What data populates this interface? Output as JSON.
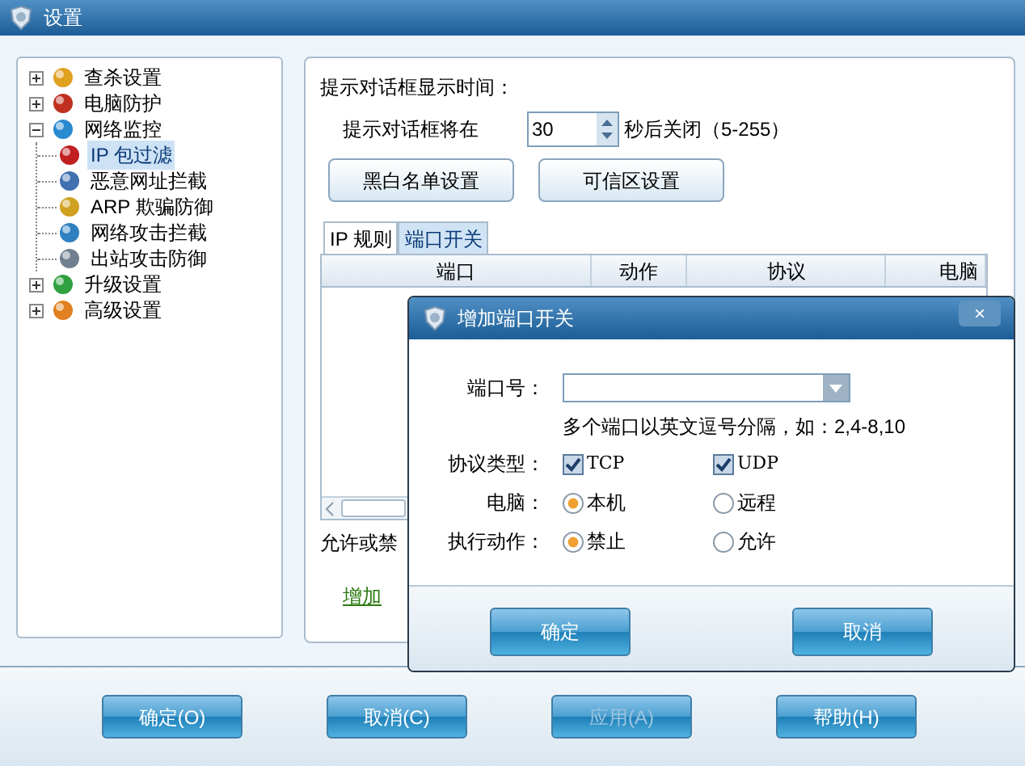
{
  "window": {
    "title": "设置"
  },
  "tree": [
    {
      "label": "查杀设置",
      "expanded": false,
      "selected": false
    },
    {
      "label": "电脑防护",
      "expanded": false,
      "selected": false
    },
    {
      "label": "网络监控",
      "expanded": true,
      "selected": false,
      "children": [
        {
          "label": "IP 包过滤",
          "selected": true
        },
        {
          "label": "恶意网址拦截",
          "selected": false
        },
        {
          "label": "ARP 欺骗防御",
          "selected": false
        },
        {
          "label": "网络攻击拦截",
          "selected": false
        },
        {
          "label": "出站攻击防御",
          "selected": false
        }
      ]
    },
    {
      "label": "升级设置",
      "expanded": false,
      "selected": false
    },
    {
      "label": "高级设置",
      "expanded": false,
      "selected": false
    }
  ],
  "panel": {
    "heading": "提示对话框显示时间：",
    "prompt_label": "提示对话框将在",
    "seconds": "30",
    "seconds_suffix": "秒后关闭（5-255）",
    "buttons": [
      "黑白名单设置",
      "可信区设置"
    ],
    "tabs": [
      {
        "label": "IP 规则",
        "selected": false
      },
      {
        "label": "端口开关",
        "selected": true
      }
    ],
    "table": {
      "columns": [
        "端口",
        "动作",
        "协议",
        "电脑"
      ]
    },
    "note": "允许或禁",
    "add_link": "增加"
  },
  "dialog": {
    "title": "增加端口开关",
    "close": "×",
    "port_label": "端口号：",
    "port_hint": "多个端口以英文逗号分隔，如：2,4-8,10",
    "protocol_label": "协议类型：",
    "protocols": [
      {
        "label": "TCP",
        "checked": true
      },
      {
        "label": "UDP",
        "checked": true
      }
    ],
    "computer_label": "电脑：",
    "computers": [
      {
        "label": "本机",
        "selected": true
      },
      {
        "label": "远程",
        "selected": false
      }
    ],
    "action_label": "执行动作：",
    "actions": [
      {
        "label": "禁止",
        "selected": true
      },
      {
        "label": "允许",
        "selected": false
      }
    ],
    "buttons": [
      "确定",
      "取消"
    ]
  },
  "footer_buttons": [
    {
      "label": "确定(O)",
      "disabled": false
    },
    {
      "label": "取消(C)",
      "disabled": false
    },
    {
      "label": "应用(A)",
      "disabled": true
    },
    {
      "label": "帮助(H)",
      "disabled": false
    }
  ]
}
